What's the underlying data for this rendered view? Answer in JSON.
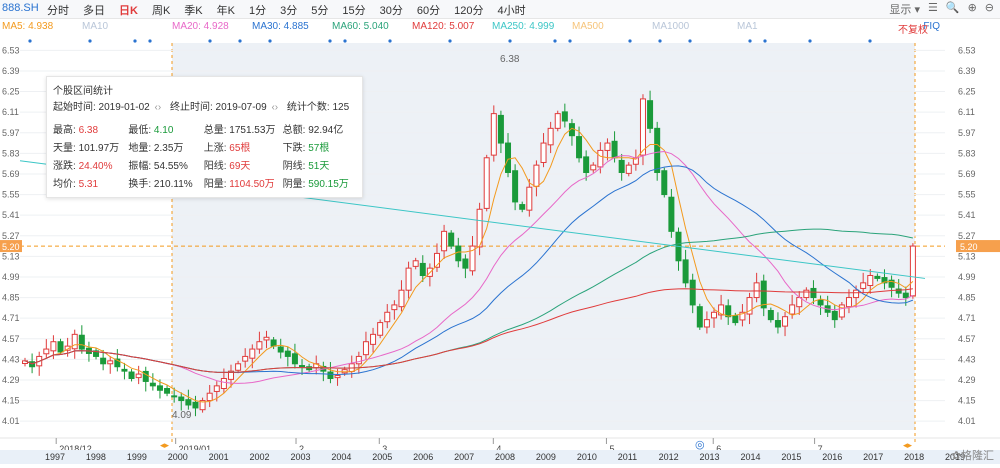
{
  "toolbar": {
    "symbol": "888.SH",
    "periods": [
      "分时",
      "多日",
      "日K",
      "周K",
      "季K",
      "年K",
      "1分",
      "3分",
      "5分",
      "15分",
      "30分",
      "60分",
      "120分",
      "4小时"
    ],
    "active_index": 2,
    "right_items": [
      "显示 ▾",
      "☰",
      "🔍",
      "⊕",
      "⊖"
    ],
    "fq_label": "FIQ",
    "fq_label2": "不复权"
  },
  "ma_labels": [
    {
      "text": "MA5: 4.938",
      "color": "#f39a1e"
    },
    {
      "text": "MA10",
      "color": "#b9c6d8"
    },
    {
      "text": "MA20: 4.928",
      "color": "#e868c8"
    },
    {
      "text": "MA30: 4.885",
      "color": "#2a73d0"
    },
    {
      "text": "MA60: 5.040",
      "color": "#2aa37a"
    },
    {
      "text": "MA120: 5.007",
      "color": "#e03b3b"
    },
    {
      "text": "MA250: 4.999",
      "color": "#3cc6c6"
    },
    {
      "text": "MA500",
      "color": "#f6c47a"
    },
    {
      "text": "MA1000",
      "color": "#b9c6d8"
    },
    {
      "text": "MA1",
      "color": "#b9c6d8"
    }
  ],
  "stats": {
    "title": "个股区间统计",
    "start_label": "起始时间: 2019-01-02",
    "end_label": "终止时间: 2019-07-09",
    "count_label": "统计个数: 125",
    "rows": [
      [
        {
          "k": "最高: ",
          "v": "6.38",
          "c": "red"
        },
        {
          "k": "最低: ",
          "v": "4.10",
          "c": "green"
        },
        {
          "k": "总量: ",
          "v": "1751.53万",
          "c": ""
        },
        {
          "k": "总额: ",
          "v": "92.94亿",
          "c": ""
        }
      ],
      [
        {
          "k": "天量: ",
          "v": "101.97万",
          "c": ""
        },
        {
          "k": "地量: ",
          "v": "2.35万",
          "c": ""
        },
        {
          "k": "上涨: ",
          "v": "65根",
          "c": "red"
        },
        {
          "k": "下跌: ",
          "v": "57根",
          "c": "green"
        }
      ],
      [
        {
          "k": "涨跌: ",
          "v": "24.40%",
          "c": "red"
        },
        {
          "k": "振幅: ",
          "v": "54.55%",
          "c": ""
        },
        {
          "k": "阳线: ",
          "v": "69天",
          "c": "red"
        },
        {
          "k": "阴线: ",
          "v": "51天",
          "c": "green"
        }
      ],
      [
        {
          "k": "均价: ",
          "v": "5.31",
          "c": "red"
        },
        {
          "k": "换手: ",
          "v": "210.11%",
          "c": ""
        },
        {
          "k": "阳量: ",
          "v": "1104.50万",
          "c": "red"
        },
        {
          "k": "阴量: ",
          "v": "590.15万",
          "c": "green"
        }
      ]
    ]
  },
  "chart_data": {
    "type": "candlestick",
    "y_ticks": [
      6.53,
      6.39,
      6.25,
      6.11,
      5.97,
      5.83,
      5.69,
      5.55,
      5.41,
      5.27,
      5.13,
      4.99,
      4.85,
      4.71,
      4.57,
      4.43,
      4.29,
      4.15,
      4.01
    ],
    "y_range": [
      3.95,
      6.58
    ],
    "current_price": "5.20",
    "high_label": "6.38",
    "low_label": "4.09",
    "month_labels": [
      {
        "text": "2018/12",
        "pos": 0.04
      },
      {
        "text": "2019/01",
        "pos": 0.172
      },
      {
        "text": "2",
        "pos": 0.305
      },
      {
        "text": "3",
        "pos": 0.397
      },
      {
        "text": "4",
        "pos": 0.523
      },
      {
        "text": "5",
        "pos": 0.648
      },
      {
        "text": "6",
        "pos": 0.766
      },
      {
        "text": "7",
        "pos": 0.878
      }
    ],
    "year_labels": [
      "1997",
      "1998",
      "1999",
      "2000",
      "2001",
      "2002",
      "2003",
      "2004",
      "2005",
      "2006",
      "2007",
      "2008",
      "2009",
      "2010",
      "2011",
      "2012",
      "2013",
      "2014",
      "2015",
      "2016",
      "2017",
      "2018",
      "2019"
    ],
    "closes": [
      4.42,
      4.38,
      4.45,
      4.5,
      4.55,
      4.48,
      4.52,
      4.6,
      4.5,
      4.47,
      4.45,
      4.4,
      4.42,
      4.38,
      4.35,
      4.3,
      4.33,
      4.28,
      4.25,
      4.22,
      4.2,
      4.18,
      4.15,
      4.12,
      4.1,
      4.15,
      4.2,
      4.25,
      4.3,
      4.35,
      4.4,
      4.45,
      4.5,
      4.55,
      4.58,
      4.52,
      4.48,
      4.45,
      4.4,
      4.38,
      4.36,
      4.4,
      4.35,
      4.3,
      4.32,
      4.36,
      4.4,
      4.45,
      4.55,
      4.6,
      4.68,
      4.75,
      4.8,
      4.9,
      5.05,
      5.1,
      5.0,
      5.05,
      5.15,
      5.3,
      5.2,
      5.1,
      5.05,
      5.2,
      5.45,
      5.8,
      6.1,
      5.9,
      5.7,
      5.5,
      5.45,
      5.6,
      5.75,
      5.9,
      6.0,
      6.1,
      6.05,
      5.95,
      5.8,
      5.7,
      5.75,
      5.85,
      5.9,
      5.8,
      5.7,
      5.75,
      5.8,
      6.2,
      6.0,
      5.7,
      5.55,
      5.3,
      5.1,
      4.95,
      4.8,
      4.65,
      4.7,
      4.75,
      4.8,
      4.72,
      4.68,
      4.75,
      4.85,
      4.95,
      4.78,
      4.7,
      4.65,
      4.72,
      4.8,
      4.85,
      4.9,
      4.85,
      4.8,
      4.75,
      4.7,
      4.8,
      4.85,
      4.9,
      4.95,
      5.0,
      4.98,
      4.95,
      4.92,
      4.88,
      4.85,
      5.2
    ]
  },
  "watermark": "格隆汇"
}
